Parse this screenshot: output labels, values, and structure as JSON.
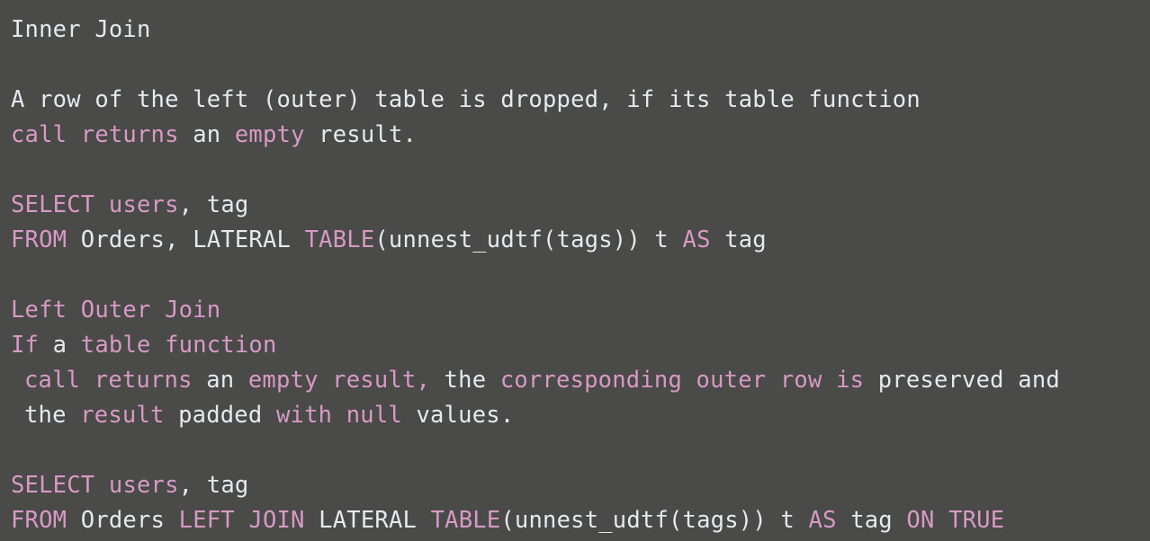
{
  "slide": {
    "background_color": "#4a4a49",
    "text_color_plain": "#e6e9ee",
    "text_color_keyword": "#d79ac4",
    "title": "Inner Join",
    "lines": [
      {
        "id": "title-inner-join",
        "indent": 0,
        "tokens": [
          {
            "text": "Inner Join",
            "style": "plain"
          }
        ]
      },
      {
        "id": "blank-1",
        "blank": true
      },
      {
        "id": "inner-join-desc-1",
        "indent": 0,
        "tokens": [
          {
            "text": "A row of the left (outer) table is dropped, if its table function",
            "style": "plain"
          }
        ]
      },
      {
        "id": "inner-join-desc-2",
        "indent": 0,
        "tokens": [
          {
            "text": "call returns",
            "style": "keyword"
          },
          {
            "text": " an ",
            "style": "plain"
          },
          {
            "text": "empty",
            "style": "keyword"
          },
          {
            "text": " result.",
            "style": "plain"
          }
        ]
      },
      {
        "id": "blank-2",
        "blank": true
      },
      {
        "id": "inner-join-sql-1",
        "indent": 0,
        "tokens": [
          {
            "text": "SELECT",
            "style": "keyword"
          },
          {
            "text": " ",
            "style": "plain"
          },
          {
            "text": "users",
            "style": "keyword"
          },
          {
            "text": ", tag",
            "style": "plain"
          }
        ]
      },
      {
        "id": "inner-join-sql-2",
        "indent": 0,
        "tokens": [
          {
            "text": "FROM",
            "style": "keyword"
          },
          {
            "text": " Orders, LATERAL ",
            "style": "plain"
          },
          {
            "text": "TABLE",
            "style": "keyword"
          },
          {
            "text": "(unnest_udtf(tags)) t ",
            "style": "plain"
          },
          {
            "text": "AS",
            "style": "keyword"
          },
          {
            "text": " tag",
            "style": "plain"
          }
        ]
      },
      {
        "id": "blank-3",
        "blank": true
      },
      {
        "id": "title-left-outer-join",
        "indent": 0,
        "tokens": [
          {
            "text": "Left Outer Join",
            "style": "keyword"
          }
        ]
      },
      {
        "id": "left-outer-desc-1",
        "indent": 0,
        "tokens": [
          {
            "text": "If",
            "style": "keyword"
          },
          {
            "text": " a ",
            "style": "plain"
          },
          {
            "text": "table function",
            "style": "keyword"
          }
        ]
      },
      {
        "id": "left-outer-desc-2",
        "indent": 1,
        "tokens": [
          {
            "text": "call returns",
            "style": "keyword"
          },
          {
            "text": " an ",
            "style": "plain"
          },
          {
            "text": "empty result,",
            "style": "keyword"
          },
          {
            "text": " the ",
            "style": "plain"
          },
          {
            "text": "corresponding outer row is",
            "style": "keyword"
          },
          {
            "text": " preserved and",
            "style": "plain"
          }
        ]
      },
      {
        "id": "left-outer-desc-3",
        "indent": 1,
        "tokens": [
          {
            "text": "the ",
            "style": "plain"
          },
          {
            "text": "result",
            "style": "keyword"
          },
          {
            "text": " padded ",
            "style": "plain"
          },
          {
            "text": "with null",
            "style": "keyword"
          },
          {
            "text": " values.",
            "style": "plain"
          }
        ]
      },
      {
        "id": "blank-4",
        "blank": true
      },
      {
        "id": "left-outer-sql-1",
        "indent": 0,
        "tokens": [
          {
            "text": "SELECT",
            "style": "keyword"
          },
          {
            "text": " ",
            "style": "plain"
          },
          {
            "text": "users",
            "style": "keyword"
          },
          {
            "text": ", tag",
            "style": "plain"
          }
        ]
      },
      {
        "id": "left-outer-sql-2",
        "indent": 0,
        "tokens": [
          {
            "text": "FROM",
            "style": "keyword"
          },
          {
            "text": " Orders ",
            "style": "plain"
          },
          {
            "text": "LEFT JOIN",
            "style": "keyword"
          },
          {
            "text": " LATERAL ",
            "style": "plain"
          },
          {
            "text": "TABLE",
            "style": "keyword"
          },
          {
            "text": "(unnest_udtf(tags)) t ",
            "style": "plain"
          },
          {
            "text": "AS",
            "style": "keyword"
          },
          {
            "text": " tag ",
            "style": "plain"
          },
          {
            "text": "ON TRUE",
            "style": "keyword"
          }
        ]
      }
    ]
  }
}
